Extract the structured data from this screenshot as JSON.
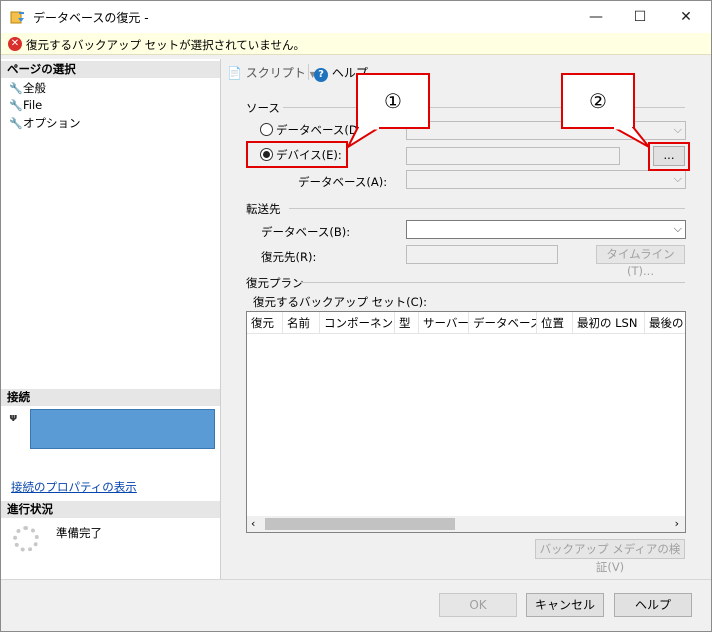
{
  "window": {
    "title": "データベースの復元 -",
    "min_glyph": "—",
    "max_glyph": "☐",
    "close_glyph": "✕"
  },
  "error": {
    "message": "復元するバックアップ セットが選択されていません。"
  },
  "left": {
    "pages_header": "ページの選択",
    "pages": [
      "全般",
      "File",
      "オプション"
    ],
    "connection_header": "接続",
    "connection_link": "接続のプロパティの表示",
    "progress_header": "進行状況",
    "progress_status": "準備完了"
  },
  "toolbar": {
    "script_label": "スクリプト",
    "help_label": "ヘルプ"
  },
  "source": {
    "group_label": "ソース",
    "database_radio": "データベース(D):",
    "device_radio": "デバイス(E):",
    "device_database_label": "データベース(A):",
    "browse_button": "..."
  },
  "destination": {
    "group_label": "転送先",
    "database_label": "データベース(B):",
    "restore_to_label": "復元先(R):",
    "timeline_button": "タイムライン(T)..."
  },
  "plan": {
    "group_label": "復元プラン",
    "sets_label": "復元するバックアップ セット(C):",
    "columns": [
      "復元",
      "名前",
      "コンポーネント",
      "型",
      "サーバー",
      "データベース",
      "位置",
      "最初の LSN",
      "最後の"
    ],
    "verify_button": "バックアップ メディアの検証(V)"
  },
  "callouts": {
    "one": "①",
    "two": "②",
    "color": "#e00000"
  },
  "footer": {
    "ok": "OK",
    "cancel": "キャンセル",
    "help": "ヘルプ"
  }
}
